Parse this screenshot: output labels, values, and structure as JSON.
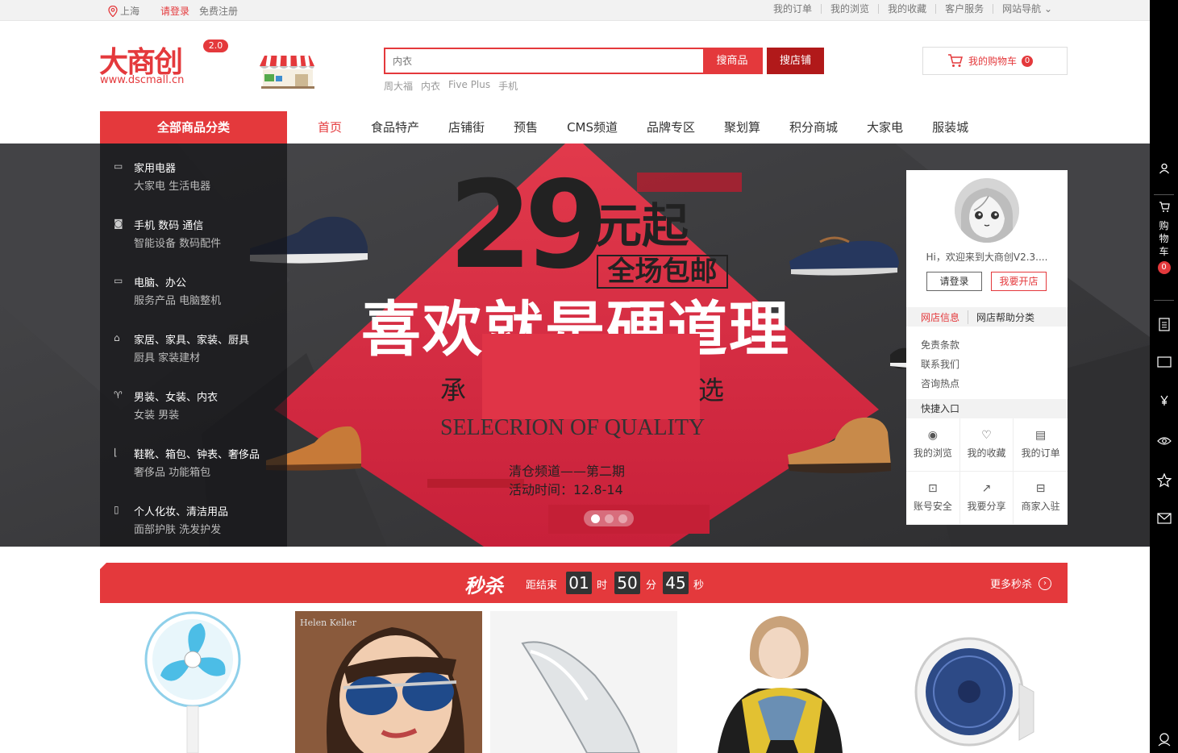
{
  "topbar": {
    "location": "上海",
    "login": "请登录",
    "register": "免费注册",
    "links": [
      "我的订单",
      "我的浏览",
      "我的收藏",
      "客户服务",
      "网站导航"
    ]
  },
  "header": {
    "logo_text": "大商创",
    "logo_badge": "2.0",
    "logo_url": "www.dscmall.cn",
    "search_placeholder": "内衣",
    "search_goods_label": "搜商品",
    "search_shop_label": "搜店铺",
    "hotwords": [
      "周大福",
      "内衣",
      "Five Plus",
      "手机"
    ],
    "cart_label": "我的购物车",
    "cart_count": "0"
  },
  "nav": {
    "all_categories": "全部商品分类",
    "items": [
      "首页",
      "食品特产",
      "店铺街",
      "预售",
      "CMS频道",
      "品牌专区",
      "聚划算",
      "积分商城",
      "大家电",
      "服装城"
    ]
  },
  "categories": [
    {
      "title": "家用电器",
      "subs": "大家电  生活电器"
    },
    {
      "title": "手机  数码  通信",
      "subs": "智能设备  数码配件"
    },
    {
      "title": "电脑、办公",
      "subs": "服务产品  电脑整机"
    },
    {
      "title": "家居、家具、家装、厨具",
      "subs": "厨具  家装建材"
    },
    {
      "title": "男装、女装、内衣",
      "subs": "女装  男装"
    },
    {
      "title": "鞋靴、箱包、钟表、奢侈品",
      "subs": "奢侈品  功能箱包"
    },
    {
      "title": "个人化妆、清洁用品",
      "subs": "面部护肤  洗发护发"
    }
  ],
  "banner": {
    "price": "29",
    "price_suffix": "元起",
    "free_ship": "全场包邮",
    "slogan": "喜欢就是硬道理",
    "sub_left": "承",
    "sub_right": "选",
    "english": "SELECRION OF QUALITY",
    "event_line1": "清仓频道——第二期",
    "event_line2": "活动时间：12.8-14",
    "active_dot": 1
  },
  "user_panel": {
    "welcome": "Hi，欢迎来到大商创V2.3....",
    "login_btn": "请登录",
    "open_shop_btn": "我要开店",
    "tab_info": "网店信息",
    "tab_help": "网店帮助分类",
    "info_links": [
      "免责条款",
      "联系我们",
      "咨询热点"
    ],
    "quick_title": "快捷入口",
    "quick_items": [
      "我的浏览",
      "我的收藏",
      "我的订单",
      "账号安全",
      "我要分享",
      "商家入驻"
    ]
  },
  "seckill": {
    "title": "秒杀",
    "end_label": "距结束",
    "hours": "01",
    "hour_unit": "时",
    "minutes": "50",
    "minute_unit": "分",
    "seconds": "45",
    "second_unit": "秒",
    "more": "更多秒杀"
  },
  "sidebar": {
    "cart_text": "购物车",
    "cart_count": "0"
  },
  "colors": {
    "brand_red": "#e4393c",
    "dark_red": "#b1191a",
    "banner_bg": "#3b3b3d"
  }
}
